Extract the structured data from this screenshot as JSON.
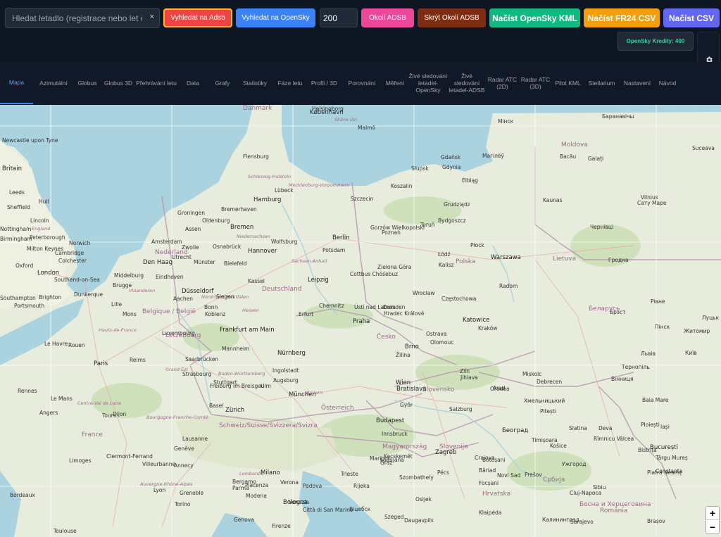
{
  "search": {
    "placeholder": "Hledat letadlo (registrace nebo let číslo",
    "clear": "×"
  },
  "toolbar": {
    "search_adsb": "Vyhledat na Adsb",
    "search_opensky": "Vyhledat na OpenSky",
    "radius_value": "200",
    "nearby_adsb": "Okolí ADSB",
    "hide_nearby_adsb": "Skrýt Okolí ADSB",
    "load_opensky_kml": "Načíst OpenSky KML",
    "load_fr24_csv": "Načíst FR24 CSV",
    "load_csv": "Načíst CSV",
    "credits": "OpenSky Kredity: 400"
  },
  "colors": {
    "red": "#ef4444",
    "blue": "#3b82f6",
    "pink": "#ec4899",
    "brown": "#7c2d12",
    "green": "#10b981",
    "orange": "#f59e0b",
    "indigo": "#6366f1",
    "accent": "#60a5fa"
  },
  "tabs": [
    {
      "label": "Mapa",
      "active": true
    },
    {
      "label": "Azimutální"
    },
    {
      "label": "Globus"
    },
    {
      "label": "Globus 3D"
    },
    {
      "label": "Přehrávání letu"
    },
    {
      "label": "Data"
    },
    {
      "label": "Grafy"
    },
    {
      "label": "Statistiky"
    },
    {
      "label": "Fáze letu"
    },
    {
      "label": "Profil / 3D"
    },
    {
      "label": "Porovnání"
    },
    {
      "label": "Měření"
    },
    {
      "label": "Živé sledování letadel-OpenSky"
    },
    {
      "label": "Živé sledování letadel-ADSB"
    },
    {
      "label": "Radar ATC (2D)"
    },
    {
      "label": "Radar ATC (3D)"
    },
    {
      "label": "Pilot KML"
    },
    {
      "label": "Stellarium"
    },
    {
      "label": "Nastavení"
    },
    {
      "label": "Návod"
    }
  ],
  "map": {
    "labels": [
      {
        "t": "Danmark",
        "k": "cnt"
      },
      {
        "t": "Helsingborg"
      },
      {
        "t": "København",
        "k": "c"
      },
      {
        "t": "Skåne län",
        "k": "reg"
      },
      {
        "t": "Malmö"
      },
      {
        "t": "Newcastle upon Tyne"
      },
      {
        "t": "Britain",
        "k": "c"
      },
      {
        "t": "Leeds"
      },
      {
        "t": "Hull"
      },
      {
        "t": "Sheffield"
      },
      {
        "t": "Lincoln"
      },
      {
        "t": "Nottingham"
      },
      {
        "t": "England",
        "k": "reg"
      },
      {
        "t": "Birmingham"
      },
      {
        "t": "Peterborough"
      },
      {
        "t": "Norwich"
      },
      {
        "t": "Milton Keynes"
      },
      {
        "t": "Cambridge"
      },
      {
        "t": "Colchester"
      },
      {
        "t": "Oxford"
      },
      {
        "t": "London",
        "k": "c"
      },
      {
        "t": "Southend-on-Sea"
      },
      {
        "t": "Brighton"
      },
      {
        "t": "Southampton"
      },
      {
        "t": "Portsmouth"
      },
      {
        "t": "Flensburg"
      },
      {
        "t": "Schleswig-Holstein",
        "k": "reg"
      },
      {
        "t": "Lübeck"
      },
      {
        "t": "Hamburg",
        "k": "c"
      },
      {
        "t": "Mecklenburg-Vorpommern",
        "k": "reg"
      },
      {
        "t": "Groningen"
      },
      {
        "t": "Bremerhaven"
      },
      {
        "t": "Oldenburg"
      },
      {
        "t": "Bremen",
        "k": "c"
      },
      {
        "t": "Assen"
      },
      {
        "t": "Niedersachsen",
        "k": "reg"
      },
      {
        "t": "Hannover",
        "k": "c"
      },
      {
        "t": "Wolfsburg"
      },
      {
        "t": "Osnabrück"
      },
      {
        "t": "Berlin",
        "k": "c"
      },
      {
        "t": "Potsdam"
      },
      {
        "t": "Nederland",
        "k": "cnt"
      },
      {
        "t": "Amsterdam"
      },
      {
        "t": "Zwolle"
      },
      {
        "t": "Den Haag",
        "k": "c"
      },
      {
        "t": "Utrecht"
      },
      {
        "t": "Münster"
      },
      {
        "t": "Bielefeld"
      },
      {
        "t": "Middelburg"
      },
      {
        "t": "Brugge"
      },
      {
        "t": "Eindhoven"
      },
      {
        "t": "Dunkerque"
      },
      {
        "t": "Vlaanderen",
        "k": "reg"
      },
      {
        "t": "Kassel"
      },
      {
        "t": "Düsseldorf",
        "k": "c"
      },
      {
        "t": "Nordrhein-Westfalen",
        "k": "reg"
      },
      {
        "t": "Aachen"
      },
      {
        "t": "Bonn"
      },
      {
        "t": "Siegen"
      },
      {
        "t": "Deutschland",
        "k": "cnt"
      },
      {
        "t": "Sachsen-Anhalt",
        "k": "reg"
      },
      {
        "t": "Leipzig",
        "k": "c"
      },
      {
        "t": "Cottbus Chóśebuz"
      },
      {
        "t": "Lille"
      },
      {
        "t": "Mons"
      },
      {
        "t": "Belgique / België",
        "k": "cnt"
      },
      {
        "t": "Koblenz"
      },
      {
        "t": "Hessen",
        "k": "reg"
      },
      {
        "t": "Erfurt"
      },
      {
        "t": "Chemnitz"
      },
      {
        "t": "Dresden"
      },
      {
        "t": "Frankfurt am Main",
        "k": "c"
      },
      {
        "t": "Luxembourg"
      },
      {
        "t": "Letzebuerg",
        "k": "cnt"
      },
      {
        "t": "Mannheim"
      },
      {
        "t": "Nürnberg",
        "k": "c"
      },
      {
        "t": "Reims"
      },
      {
        "t": "Le Havre"
      },
      {
        "t": "Rouen"
      },
      {
        "t": "Hauts-de-France",
        "k": "reg"
      },
      {
        "t": "Saarbrücken"
      },
      {
        "t": "Paris",
        "k": "c"
      },
      {
        "t": "Grand Est",
        "k": "reg"
      },
      {
        "t": "Strasbourg"
      },
      {
        "t": "Stuttgart"
      },
      {
        "t": "Ingolstadt"
      },
      {
        "t": "Augsburg"
      },
      {
        "t": "Baden-Württemberg",
        "k": "reg"
      },
      {
        "t": "Freiburg im Breisgau"
      },
      {
        "t": "Ulm"
      },
      {
        "t": "München",
        "k": "c"
      },
      {
        "t": "Bayern",
        "k": "reg"
      },
      {
        "t": "Rennes"
      },
      {
        "t": "Le Mans"
      },
      {
        "t": "Angers"
      },
      {
        "t": "Centre-Val de Loire",
        "k": "reg"
      },
      {
        "t": "Tours"
      },
      {
        "t": "Dijon"
      },
      {
        "t": "Basel"
      },
      {
        "t": "Zürich",
        "k": "c"
      },
      {
        "t": "France",
        "k": "cnt"
      },
      {
        "t": "Bourgogne-Franche-Comté",
        "k": "reg"
      },
      {
        "t": "Schweiz/Suisse/Svizzera/Svizra",
        "k": "cnt"
      },
      {
        "t": "Lausanne"
      },
      {
        "t": "Genève"
      },
      {
        "t": "Limoges"
      },
      {
        "t": "Clermont-Ferrand"
      },
      {
        "t": "Villeurbanne"
      },
      {
        "t": "Annecy"
      },
      {
        "t": "Lyon"
      },
      {
        "t": "Auvergne-Rhône-Alpes",
        "k": "reg"
      },
      {
        "t": "Bordeaux"
      },
      {
        "t": "Toulouse"
      },
      {
        "t": "Grenoble"
      },
      {
        "t": "Torino"
      },
      {
        "t": "Milano",
        "k": "c"
      },
      {
        "t": "Bergamo"
      },
      {
        "t": "Lombardia",
        "k": "reg"
      },
      {
        "t": "Piacenza"
      },
      {
        "t": "Parma"
      },
      {
        "t": "Genova"
      },
      {
        "t": "Modena"
      },
      {
        "t": "Bologna",
        "k": "c"
      },
      {
        "t": "Verona"
      },
      {
        "t": "Padova"
      },
      {
        "t": "Venezia"
      },
      {
        "t": "Trieste"
      },
      {
        "t": "Rijeka"
      },
      {
        "t": "Firenze"
      },
      {
        "t": "Città di San Marino"
      },
      {
        "t": "Gdynia"
      },
      {
        "t": "Gdańsk"
      },
      {
        "t": "Słupsk"
      },
      {
        "t": "Koszalin"
      },
      {
        "t": "Elbląg"
      },
      {
        "t": "Szczecin"
      },
      {
        "t": "Gorzów Wielkopolski"
      },
      {
        "t": "Grudziądz"
      },
      {
        "t": "Toruń"
      },
      {
        "t": "Bydgoszcz"
      },
      {
        "t": "Płock"
      },
      {
        "t": "Warszawa",
        "k": "c"
      },
      {
        "t": "Polska",
        "k": "cnt"
      },
      {
        "t": "Zielona Góra"
      },
      {
        "t": "Poznań"
      },
      {
        "t": "Łódź"
      },
      {
        "t": "Kalisz"
      },
      {
        "t": "Radom"
      },
      {
        "t": "Wrocław"
      },
      {
        "t": "Ústí nad Labem"
      },
      {
        "t": "Hradec Králové"
      },
      {
        "t": "Praha",
        "k": "c"
      },
      {
        "t": "Česko",
        "k": "cnt"
      },
      {
        "t": "Częstochowa"
      },
      {
        "t": "Katowice",
        "k": "c"
      },
      {
        "t": "Kraków"
      },
      {
        "t": "Ostrava"
      },
      {
        "t": "Olomouc"
      },
      {
        "t": "Brno",
        "k": "c"
      },
      {
        "t": "Zlín"
      },
      {
        "t": "Jihlava"
      },
      {
        "t": "Žilina"
      },
      {
        "t": "Slovensko",
        "k": "cnt"
      },
      {
        "t": "Wien",
        "k": "c"
      },
      {
        "t": "Bratislava",
        "k": "c"
      },
      {
        "t": "Győr"
      },
      {
        "t": "Österreich",
        "k": "cnt"
      },
      {
        "t": "Salzburg"
      },
      {
        "t": "Innsbruck"
      },
      {
        "t": "Budapest",
        "k": "c"
      },
      {
        "t": "Szombathely"
      },
      {
        "t": "Magyarország",
        "k": "cnt"
      },
      {
        "t": "Kecskemét"
      },
      {
        "t": "Graz"
      },
      {
        "t": "Maribor"
      },
      {
        "t": "Ljubljana"
      },
      {
        "t": "Slovenija",
        "k": "cnt"
      },
      {
        "t": "Zagreb",
        "k": "c"
      },
      {
        "t": "Pécs"
      },
      {
        "t": "Szeged"
      },
      {
        "t": "Osijek"
      },
      {
        "t": "Hrvatska",
        "k": "cnt"
      },
      {
        "t": "Novi Sad"
      },
      {
        "t": "Београд",
        "k": "c"
      },
      {
        "t": "Timișoara"
      },
      {
        "t": "Arad"
      },
      {
        "t": "Oradea"
      },
      {
        "t": "Debrecen"
      },
      {
        "t": "Miskolc"
      },
      {
        "t": "Košice"
      },
      {
        "t": "Prešov"
      },
      {
        "t": "Ужгород"
      },
      {
        "t": "Cluj-Napoca"
      },
      {
        "t": "Sibiu"
      },
      {
        "t": "România",
        "k": "cnt"
      },
      {
        "t": "Brașov"
      },
      {
        "t": "Ploiești"
      },
      {
        "t": "București",
        "k": "c"
      },
      {
        "t": "Constanța"
      },
      {
        "t": "Iași"
      },
      {
        "t": "Bacău"
      },
      {
        "t": "Galați"
      },
      {
        "t": "Moldova",
        "k": "cnt"
      },
      {
        "t": "Kaunas"
      },
      {
        "t": "Vilnius"
      },
      {
        "t": "Lietuva",
        "k": "cnt"
      },
      {
        "t": "Гродна"
      },
      {
        "t": "Беларусь",
        "k": "cnt"
      },
      {
        "t": "Брэст"
      },
      {
        "t": "Пінск"
      },
      {
        "t": "Луцьк"
      },
      {
        "t": "Рівне"
      },
      {
        "t": "Житомир"
      },
      {
        "t": "Київ"
      },
      {
        "t": "Львів"
      },
      {
        "t": "Тернопіль"
      },
      {
        "t": "Хмельницький"
      },
      {
        "t": "Вінниця"
      },
      {
        "t": "Чернівці"
      },
      {
        "t": "Сату Маре"
      },
      {
        "t": "Suceava"
      },
      {
        "t": "Баранавічы"
      },
      {
        "t": "Мінск"
      },
      {
        "t": "Магілёў"
      },
      {
        "t": "Віцебск"
      },
      {
        "t": "Daugavpils"
      },
      {
        "t": "Klaipėda"
      },
      {
        "t": "Калининград"
      },
      {
        "t": "Sarajevo"
      },
      {
        "t": "Босна и Херцеговина",
        "k": "cnt"
      },
      {
        "t": "Србија",
        "k": "cnt"
      },
      {
        "t": "Craiova"
      },
      {
        "t": "Pitești"
      },
      {
        "t": "Slatina"
      },
      {
        "t": "Rîmnicu Vâlcea"
      },
      {
        "t": "Deva"
      },
      {
        "t": "Baia Mare"
      },
      {
        "t": "Bistrița"
      },
      {
        "t": "Târgu Mureș"
      },
      {
        "t": "Piatra Neamț"
      },
      {
        "t": "Botoșani"
      },
      {
        "t": "Bârlad"
      },
      {
        "t": "Focșani"
      },
      {
        "t": "Buzău"
      },
      {
        "t": "Alba Iulia"
      },
      {
        "t": "Hunedoara"
      },
      {
        "t": "Reșița"
      }
    ]
  }
}
